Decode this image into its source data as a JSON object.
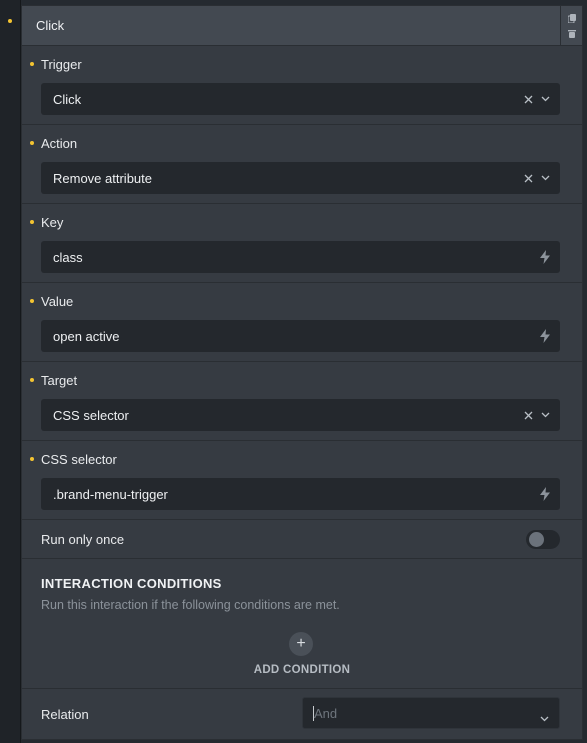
{
  "panel": {
    "title": "Click",
    "actions": {
      "copy_icon": "copy-icon",
      "delete_icon": "trash-icon"
    }
  },
  "fields": [
    {
      "label": "Trigger",
      "value": "Click",
      "control": "select"
    },
    {
      "label": "Action",
      "value": "Remove attribute",
      "control": "select"
    },
    {
      "label": "Key",
      "value": "class",
      "control": "text-dynamic"
    },
    {
      "label": "Value",
      "value": "open active",
      "control": "text-dynamic"
    },
    {
      "label": "Target",
      "value": "CSS selector",
      "control": "select"
    },
    {
      "label": "CSS selector",
      "value": ".brand-menu-trigger",
      "control": "text-dynamic"
    }
  ],
  "run_once": {
    "label": "Run only once",
    "enabled": false
  },
  "conditions": {
    "title": "INTERACTION CONDITIONS",
    "description": "Run this interaction if the following conditions are met.",
    "add_label": "ADD CONDITION"
  },
  "relation": {
    "label": "Relation",
    "placeholder": "And"
  },
  "colors": {
    "accent_dot": "#f4c431",
    "panel_bg": "#363b42",
    "input_bg": "#24282d"
  }
}
